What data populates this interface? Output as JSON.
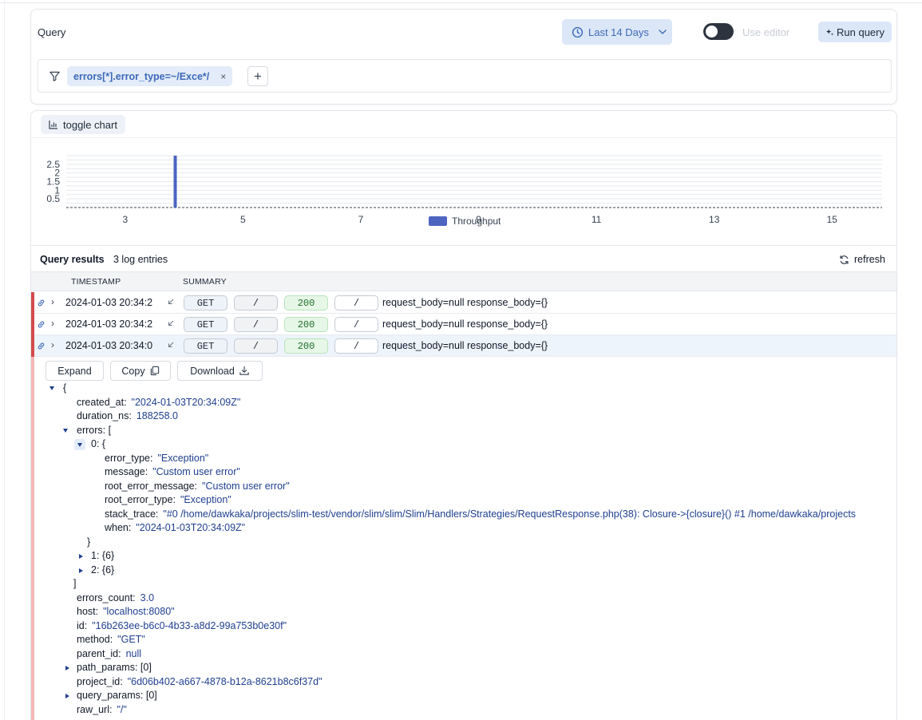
{
  "query": {
    "label": "Query",
    "date_range": "Last 14 Days",
    "use_editor_label": "Use editor",
    "run_query_label": "Run query",
    "filter_chip": "errors[*].error_type=~/Exce*/",
    "chip_remove": "×",
    "add_filter": "+"
  },
  "chart": {
    "toggle_label": "toggle chart",
    "colors": {
      "bar": "#4d64c1"
    }
  },
  "chart_data": {
    "type": "bar",
    "x": [
      3.85
    ],
    "values": [
      3
    ],
    "series": [
      {
        "name": "Throughput",
        "values": [
          3
        ]
      }
    ],
    "xticks": [
      "3",
      "5",
      "7",
      "9",
      "11",
      "13",
      "15"
    ],
    "yticks": [
      "0.5",
      "1",
      "1.5",
      "2",
      "2.5"
    ],
    "xlim": [
      2,
      15.85
    ],
    "ylim": [
      0,
      3
    ],
    "grid": true,
    "legend": "bottom-center"
  },
  "results": {
    "title": "Query results",
    "count_text": "3  log entries",
    "refresh_label": "refresh",
    "columns": [
      "TIMESTAMP",
      "SUMMARY"
    ],
    "rows": [
      {
        "timestamp": "2024-01-03 20:34:2",
        "method": "GET",
        "path": "/",
        "status": "200",
        "route": "/",
        "summary": "request_body=null response_body={}"
      },
      {
        "timestamp": "2024-01-03 20:34:2",
        "method": "GET",
        "path": "/",
        "status": "200",
        "route": "/",
        "summary": "request_body=null response_body={}"
      },
      {
        "timestamp": "2024-01-03 20:34:0",
        "method": "GET",
        "path": "/",
        "status": "200",
        "route": "/",
        "summary": "request_body=null response_body={}"
      }
    ]
  },
  "detail": {
    "expand_label": "Expand",
    "copy_label": "Copy",
    "download_label": "Download",
    "json": {
      "open_brace": "{",
      "created_at_key": "created_at:",
      "created_at_val": "\"2024-01-03T20:34:09Z\"",
      "duration_key": "duration_ns:",
      "duration_val": "188258.0",
      "errors_key": "errors: [",
      "e0_key": "0: {",
      "error_type_key": "error_type:",
      "error_type_val": "\"Exception\"",
      "message_key": "message:",
      "message_val": "\"Custom user error\"",
      "root_msg_key": "root_error_message:",
      "root_msg_val": "\"Custom user error\"",
      "root_type_key": "root_error_type:",
      "root_type_val": "\"Exception\"",
      "stack_key": "stack_trace:",
      "stack_val": "\"#0 /home/dawkaka/projects/slim-test/vendor/slim/slim/Slim/Handlers/Strategies/RequestResponse.php(38): Closure->{closure}() #1 /home/dawkaka/projects",
      "when_key": "when:",
      "when_val": "\"2024-01-03T20:34:09Z\"",
      "close_e0": "}",
      "e1_key": "1: {6}",
      "e2_key": "2: {6}",
      "close_errors": "]",
      "errors_count_key": "errors_count:",
      "errors_count_val": "3.0",
      "host_key": "host:",
      "host_val": "\"localhost:8080\"",
      "id_key": "id:",
      "id_val": "\"16b263ee-b6c0-4b33-a8d2-99a753b0e30f\"",
      "method_key": "method:",
      "method_val": "\"GET\"",
      "parent_key": "parent_id:",
      "parent_val": "null",
      "path_params_key": "path_params: [0]",
      "project_key": "project_id:",
      "project_val": "\"6d06b402-a667-4878-b12a-8621b8c6f37d\"",
      "query_params_key": "query_params: [0]",
      "raw_url_key": "raw_url:",
      "raw_url_val": "\"/\""
    }
  }
}
